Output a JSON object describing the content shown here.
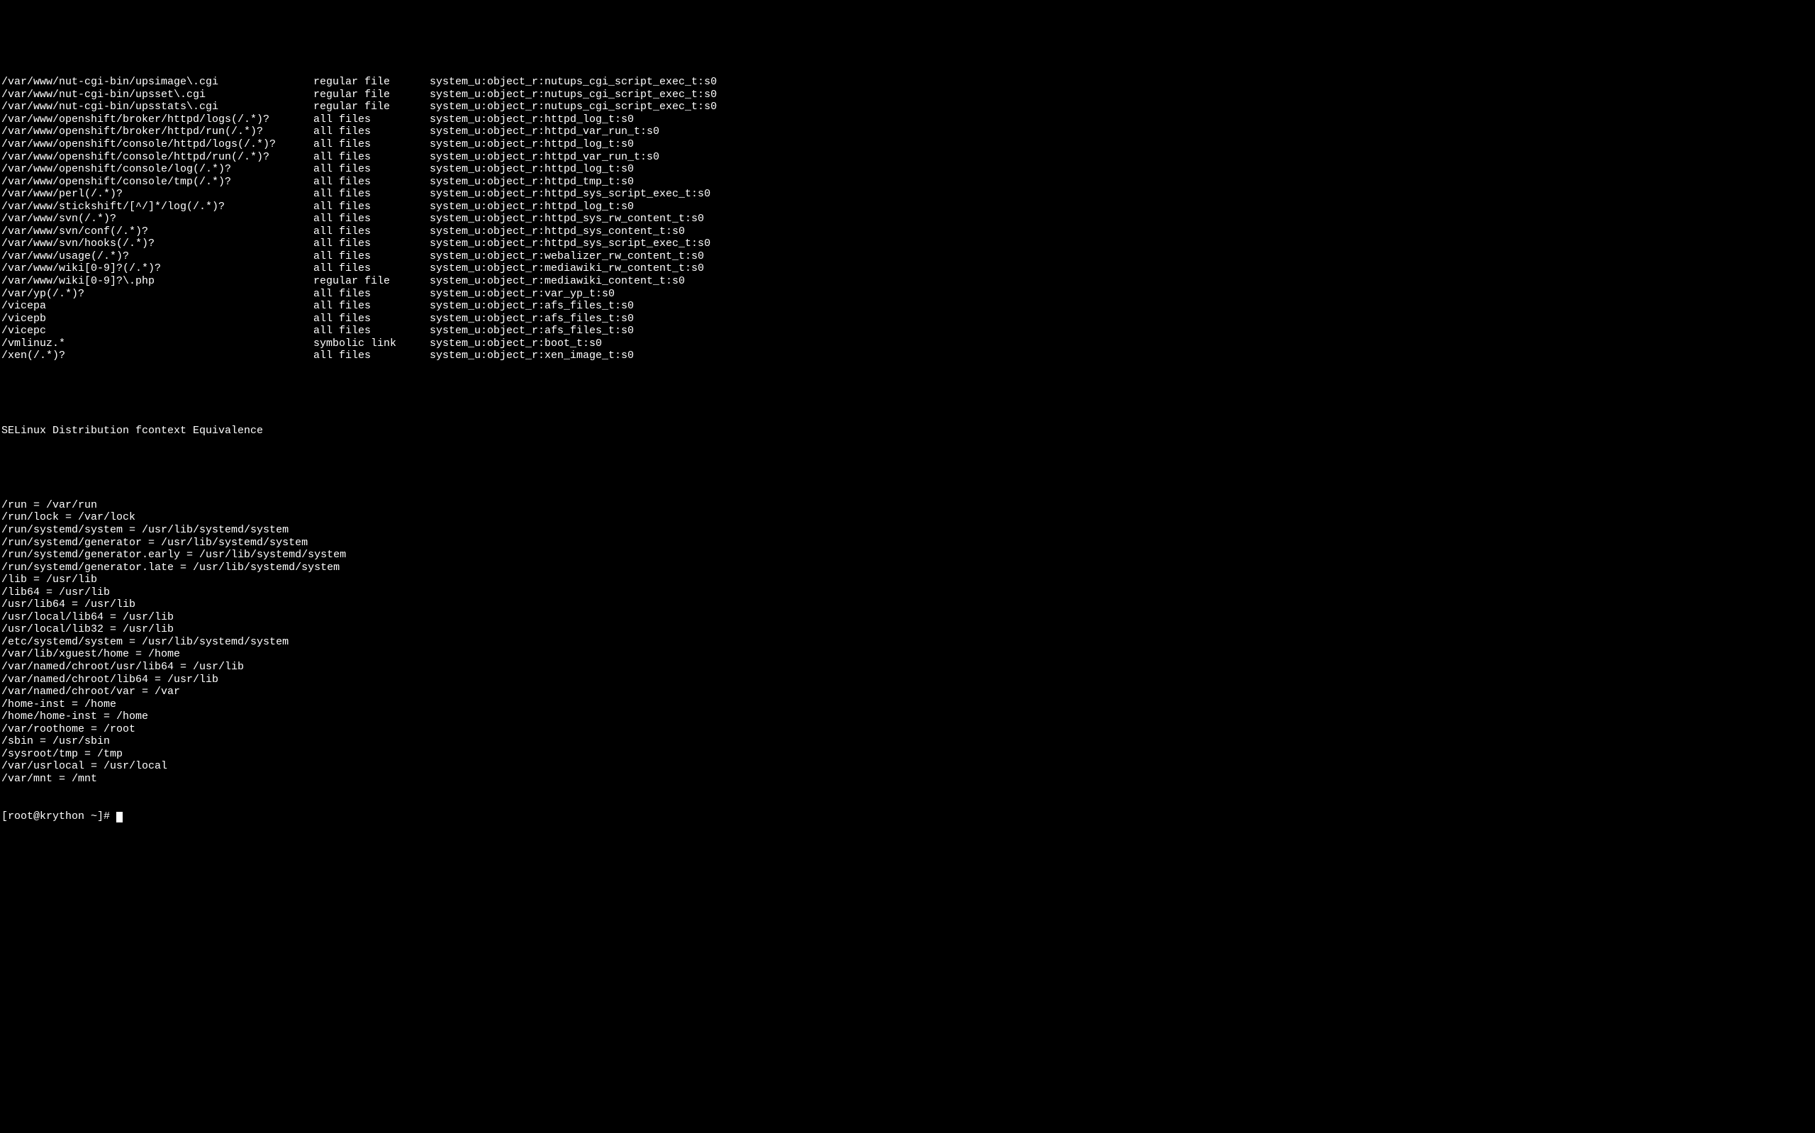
{
  "fcontext_rows": [
    {
      "path": "/var/www/nut-cgi-bin/upsimage\\.cgi",
      "type": "regular file",
      "context": "system_u:object_r:nutups_cgi_script_exec_t:s0"
    },
    {
      "path": "/var/www/nut-cgi-bin/upsset\\.cgi",
      "type": "regular file",
      "context": "system_u:object_r:nutups_cgi_script_exec_t:s0"
    },
    {
      "path": "/var/www/nut-cgi-bin/upsstats\\.cgi",
      "type": "regular file",
      "context": "system_u:object_r:nutups_cgi_script_exec_t:s0"
    },
    {
      "path": "/var/www/openshift/broker/httpd/logs(/.*)?",
      "type": "all files",
      "context": "system_u:object_r:httpd_log_t:s0"
    },
    {
      "path": "/var/www/openshift/broker/httpd/run(/.*)?",
      "type": "all files",
      "context": "system_u:object_r:httpd_var_run_t:s0"
    },
    {
      "path": "/var/www/openshift/console/httpd/logs(/.*)?",
      "type": "all files",
      "context": "system_u:object_r:httpd_log_t:s0"
    },
    {
      "path": "/var/www/openshift/console/httpd/run(/.*)?",
      "type": "all files",
      "context": "system_u:object_r:httpd_var_run_t:s0"
    },
    {
      "path": "/var/www/openshift/console/log(/.*)?",
      "type": "all files",
      "context": "system_u:object_r:httpd_log_t:s0"
    },
    {
      "path": "/var/www/openshift/console/tmp(/.*)?",
      "type": "all files",
      "context": "system_u:object_r:httpd_tmp_t:s0"
    },
    {
      "path": "/var/www/perl(/.*)?",
      "type": "all files",
      "context": "system_u:object_r:httpd_sys_script_exec_t:s0"
    },
    {
      "path": "/var/www/stickshift/[^/]*/log(/.*)?",
      "type": "all files",
      "context": "system_u:object_r:httpd_log_t:s0"
    },
    {
      "path": "/var/www/svn(/.*)?",
      "type": "all files",
      "context": "system_u:object_r:httpd_sys_rw_content_t:s0"
    },
    {
      "path": "/var/www/svn/conf(/.*)?",
      "type": "all files",
      "context": "system_u:object_r:httpd_sys_content_t:s0"
    },
    {
      "path": "/var/www/svn/hooks(/.*)?",
      "type": "all files",
      "context": "system_u:object_r:httpd_sys_script_exec_t:s0"
    },
    {
      "path": "/var/www/usage(/.*)?",
      "type": "all files",
      "context": "system_u:object_r:webalizer_rw_content_t:s0"
    },
    {
      "path": "/var/www/wiki[0-9]?(/.*)?",
      "type": "all files",
      "context": "system_u:object_r:mediawiki_rw_content_t:s0"
    },
    {
      "path": "/var/www/wiki[0-9]?\\.php",
      "type": "regular file",
      "context": "system_u:object_r:mediawiki_content_t:s0"
    },
    {
      "path": "/var/yp(/.*)?",
      "type": "all files",
      "context": "system_u:object_r:var_yp_t:s0"
    },
    {
      "path": "/vicepa",
      "type": "all files",
      "context": "system_u:object_r:afs_files_t:s0"
    },
    {
      "path": "/vicepb",
      "type": "all files",
      "context": "system_u:object_r:afs_files_t:s0"
    },
    {
      "path": "/vicepc",
      "type": "all files",
      "context": "system_u:object_r:afs_files_t:s0"
    },
    {
      "path": "/vmlinuz.*",
      "type": "symbolic link",
      "context": "system_u:object_r:boot_t:s0"
    },
    {
      "path": "/xen(/.*)?",
      "type": "all files",
      "context": "system_u:object_r:xen_image_t:s0"
    }
  ],
  "section_heading": "SELinux Distribution fcontext Equivalence ",
  "equivalence_lines": [
    "/run = /var/run",
    "/run/lock = /var/lock",
    "/run/systemd/system = /usr/lib/systemd/system",
    "/run/systemd/generator = /usr/lib/systemd/system",
    "/run/systemd/generator.early = /usr/lib/systemd/system",
    "/run/systemd/generator.late = /usr/lib/systemd/system",
    "/lib = /usr/lib",
    "/lib64 = /usr/lib",
    "/usr/lib64 = /usr/lib",
    "/usr/local/lib64 = /usr/lib",
    "/usr/local/lib32 = /usr/lib",
    "/etc/systemd/system = /usr/lib/systemd/system",
    "/var/lib/xguest/home = /home",
    "/var/named/chroot/usr/lib64 = /usr/lib",
    "/var/named/chroot/lib64 = /usr/lib",
    "/var/named/chroot/var = /var",
    "/home-inst = /home",
    "/home/home-inst = /home",
    "/var/roothome = /root",
    "/sbin = /usr/sbin",
    "/sysroot/tmp = /tmp",
    "/var/usrlocal = /usr/local",
    "/var/mnt = /mnt"
  ],
  "prompt": "[root@krython ~]# "
}
